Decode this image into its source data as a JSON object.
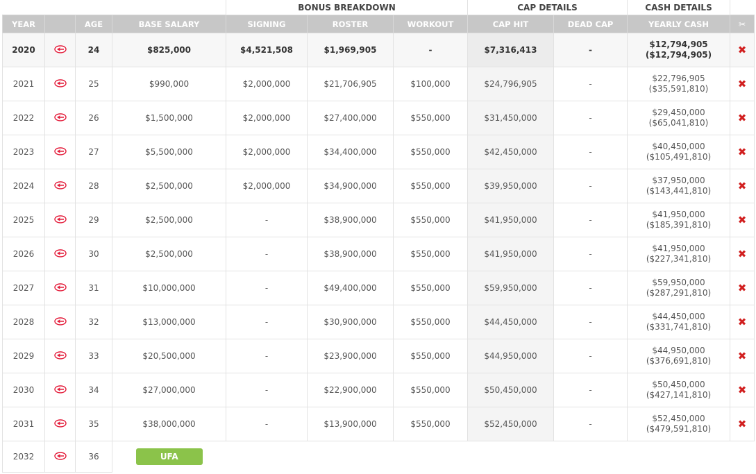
{
  "group_headers": {
    "bonus": "BONUS BREAKDOWN",
    "cap": "CAP DETAILS",
    "cash": "CASH DETAILS"
  },
  "columns": {
    "year": "YEAR",
    "age": "AGE",
    "base": "BASE SALARY",
    "signing": "SIGNING",
    "roster": "ROSTER",
    "workout": "WORKOUT",
    "caphit": "CAP HIT",
    "deadcap": "DEAD CAP",
    "yearly": "YEARLY CASH",
    "cut_icon": "scissors-icon"
  },
  "team_logo_icon": "chiefs-arrowhead-logo",
  "remove_icon": "close-x-icon",
  "rows": [
    {
      "year": "2020",
      "age": "24",
      "base": "$825,000",
      "signing": "$4,521,508",
      "roster": "$1,969,905",
      "workout": "-",
      "caphit": "$7,316,413",
      "deadcap": "-",
      "cash1": "$12,794,905",
      "cash2": "($12,794,905)"
    },
    {
      "year": "2021",
      "age": "25",
      "base": "$990,000",
      "signing": "$2,000,000",
      "roster": "$21,706,905",
      "workout": "$100,000",
      "caphit": "$24,796,905",
      "deadcap": "-",
      "cash1": "$22,796,905",
      "cash2": "($35,591,810)"
    },
    {
      "year": "2022",
      "age": "26",
      "base": "$1,500,000",
      "signing": "$2,000,000",
      "roster": "$27,400,000",
      "workout": "$550,000",
      "caphit": "$31,450,000",
      "deadcap": "-",
      "cash1": "$29,450,000",
      "cash2": "($65,041,810)"
    },
    {
      "year": "2023",
      "age": "27",
      "base": "$5,500,000",
      "signing": "$2,000,000",
      "roster": "$34,400,000",
      "workout": "$550,000",
      "caphit": "$42,450,000",
      "deadcap": "-",
      "cash1": "$40,450,000",
      "cash2": "($105,491,810)"
    },
    {
      "year": "2024",
      "age": "28",
      "base": "$2,500,000",
      "signing": "$2,000,000",
      "roster": "$34,900,000",
      "workout": "$550,000",
      "caphit": "$39,950,000",
      "deadcap": "-",
      "cash1": "$37,950,000",
      "cash2": "($143,441,810)"
    },
    {
      "year": "2025",
      "age": "29",
      "base": "$2,500,000",
      "signing": "-",
      "roster": "$38,900,000",
      "workout": "$550,000",
      "caphit": "$41,950,000",
      "deadcap": "-",
      "cash1": "$41,950,000",
      "cash2": "($185,391,810)"
    },
    {
      "year": "2026",
      "age": "30",
      "base": "$2,500,000",
      "signing": "-",
      "roster": "$38,900,000",
      "workout": "$550,000",
      "caphit": "$41,950,000",
      "deadcap": "-",
      "cash1": "$41,950,000",
      "cash2": "($227,341,810)"
    },
    {
      "year": "2027",
      "age": "31",
      "base": "$10,000,000",
      "signing": "-",
      "roster": "$49,400,000",
      "workout": "$550,000",
      "caphit": "$59,950,000",
      "deadcap": "-",
      "cash1": "$59,950,000",
      "cash2": "($287,291,810)"
    },
    {
      "year": "2028",
      "age": "32",
      "base": "$13,000,000",
      "signing": "-",
      "roster": "$30,900,000",
      "workout": "$550,000",
      "caphit": "$44,450,000",
      "deadcap": "-",
      "cash1": "$44,450,000",
      "cash2": "($331,741,810)"
    },
    {
      "year": "2029",
      "age": "33",
      "base": "$20,500,000",
      "signing": "-",
      "roster": "$23,900,000",
      "workout": "$550,000",
      "caphit": "$44,950,000",
      "deadcap": "-",
      "cash1": "$44,950,000",
      "cash2": "($376,691,810)"
    },
    {
      "year": "2030",
      "age": "34",
      "base": "$27,000,000",
      "signing": "-",
      "roster": "$22,900,000",
      "workout": "$550,000",
      "caphit": "$50,450,000",
      "deadcap": "-",
      "cash1": "$50,450,000",
      "cash2": "($427,141,810)"
    },
    {
      "year": "2031",
      "age": "35",
      "base": "$38,000,000",
      "signing": "-",
      "roster": "$13,900,000",
      "workout": "$550,000",
      "caphit": "$52,450,000",
      "deadcap": "-",
      "cash1": "$52,450,000",
      "cash2": "($479,591,810)"
    }
  ],
  "final_row": {
    "year": "2032",
    "age": "36",
    "status": "UFA"
  },
  "colors": {
    "header_bg": "#c7c7c7",
    "remove": "#d11f1f",
    "ufa": "#8bc34a",
    "chiefs_red": "#e31837"
  }
}
